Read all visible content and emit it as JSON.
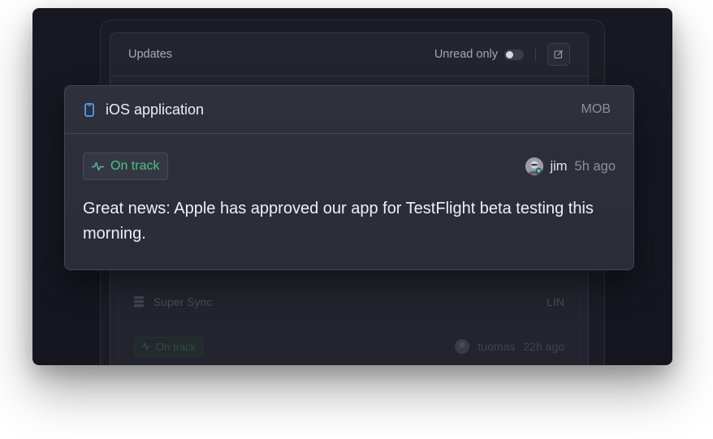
{
  "updates": {
    "title": "Updates",
    "unread_label": "Unread only",
    "unread_enabled": false
  },
  "card": {
    "project_name": "iOS application",
    "project_code": "MOB",
    "status_label": "On track",
    "author": "jim",
    "time": "5h ago",
    "message": "Great news: Apple has approved our app for TestFlight beta testing this morning.",
    "colors": {
      "status": "#4cc38a",
      "icon": "#4ea7fc"
    }
  },
  "faded_card": {
    "project_name": "Super Sync",
    "project_code": "LIN",
    "status_label": "On track",
    "author": "tuomas",
    "time": "22h ago"
  }
}
